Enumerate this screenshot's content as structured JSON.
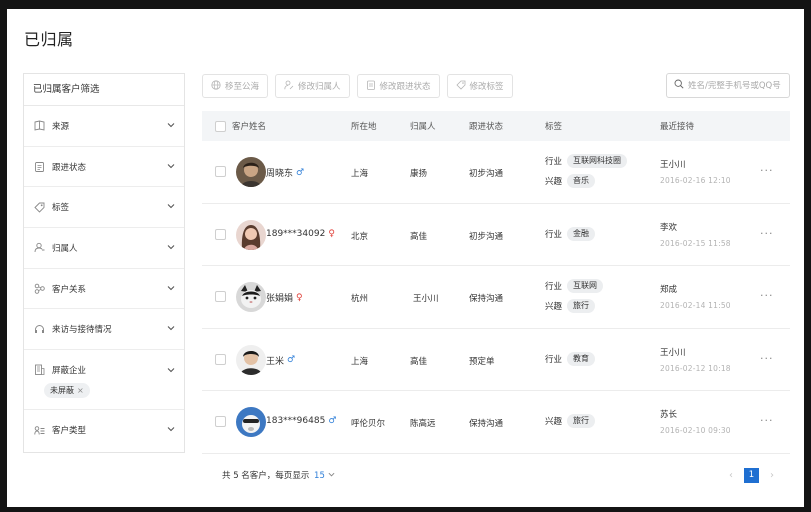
{
  "page_title": "已归属",
  "filter": {
    "title": "已归属客户筛选",
    "items": [
      {
        "label": "来源",
        "icon": "book-icon"
      },
      {
        "label": "跟进状态",
        "icon": "clipboard-icon"
      },
      {
        "label": "标签",
        "icon": "tag-icon"
      },
      {
        "label": "归属人",
        "icon": "user-icon"
      },
      {
        "label": "客户关系",
        "icon": "relation-icon"
      },
      {
        "label": "来访与接待情况",
        "icon": "headset-icon"
      },
      {
        "label": "屏蔽企业",
        "icon": "building-icon",
        "tag": "未屏蔽"
      },
      {
        "label": "客户类型",
        "icon": "list-user-icon"
      }
    ]
  },
  "toolbar": {
    "buttons": [
      {
        "label": "移至公海",
        "icon": "globe-icon"
      },
      {
        "label": "修改归属人",
        "icon": "user-edit-icon"
      },
      {
        "label": "修改跟进状态",
        "icon": "clipboard-icon"
      },
      {
        "label": "修改标签",
        "icon": "tag-icon"
      }
    ],
    "search_placeholder": "姓名/完整手机号或QQ号"
  },
  "table": {
    "headers": {
      "name": "客户姓名",
      "location": "所在地",
      "owner": "归属人",
      "status": "跟进状态",
      "tags": "标签",
      "recent": "最近接待"
    },
    "rows": [
      {
        "name": "周晓东",
        "sex": "♂",
        "location": "上海",
        "owner": "康扬",
        "status": "初步沟通",
        "tags": [
          {
            "k": "行业",
            "v": "互联网科技圈"
          },
          {
            "k": "兴趣",
            "v": "音乐"
          }
        ],
        "recent_name": "王小川",
        "recent_time": "2016-02-16  12:10"
      },
      {
        "name": "189***34092",
        "sex": "♀",
        "location": "北京",
        "owner": "高佳",
        "status": "初步沟通",
        "tags": [
          {
            "k": "行业",
            "v": "金融"
          }
        ],
        "recent_name": "李欢",
        "recent_time": "2016-02-15  11:58"
      },
      {
        "name": "张娟娟",
        "sex": "♀",
        "location": "杭州",
        "owner": "王小川",
        "status": "保持沟通",
        "tags": [
          {
            "k": "行业",
            "v": "互联网"
          },
          {
            "k": "兴趣",
            "v": "旅行"
          }
        ],
        "recent_name": "郑成",
        "recent_time": "2016-02-14  11:50"
      },
      {
        "name": "王米",
        "sex": "♂",
        "location": "上海",
        "owner": "高佳",
        "status": "预定单",
        "tags": [
          {
            "k": "行业",
            "v": "教育"
          }
        ],
        "recent_name": "王小川",
        "recent_time": "2016-02-12  10:18"
      },
      {
        "name": "183***96485",
        "sex": "♂",
        "location": "呼伦贝尔",
        "owner": "陈高远",
        "status": "保持沟通",
        "tags": [
          {
            "k": "兴趣",
            "v": "旅行"
          }
        ],
        "recent_name": "苏长",
        "recent_time": "2016-02-10  09:30"
      }
    ],
    "more_label": "···"
  },
  "footer": {
    "text": "共 5 名客户，每页显示",
    "page_size": "15",
    "current_page": "1",
    "prev": "‹",
    "next": "›"
  },
  "colors": {
    "accent": "#1f6fd1",
    "male": "#2f7fd8",
    "female": "#e0413a"
  }
}
